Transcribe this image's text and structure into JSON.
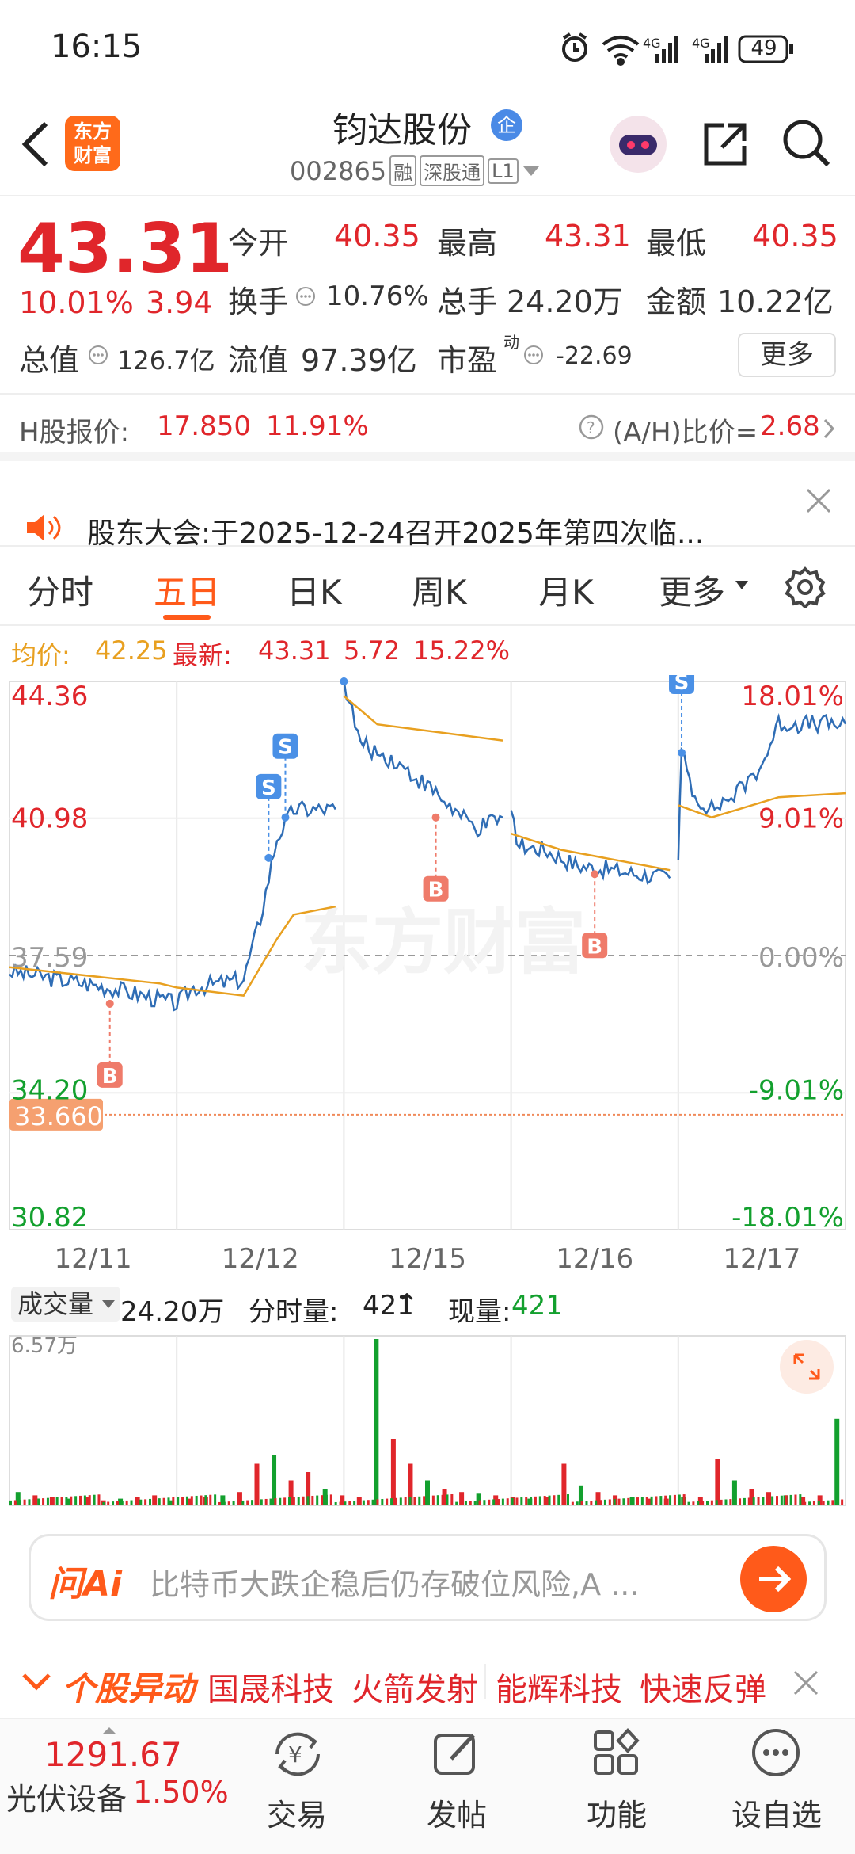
{
  "status": {
    "time": "16:15",
    "battery": "49"
  },
  "nav": {
    "logo_line1": "东方",
    "logo_line2": "财富",
    "title": "钧达股份",
    "badge": "企",
    "code": "002865",
    "tags": [
      "融",
      "深股通",
      "L1"
    ]
  },
  "quote": {
    "price": "43.31",
    "change_pct": "10.01%",
    "change": "3.94",
    "open_label": "今开",
    "open": "40.35",
    "high_label": "最高",
    "high": "43.31",
    "low_label": "最低",
    "low": "40.35",
    "turnover_label": "换手",
    "turnover": "10.76%",
    "vol_label": "总手",
    "vol": "24.20万",
    "amount_label": "金额",
    "amount": "10.22亿",
    "mcap_label": "总值",
    "mcap": "126.7亿",
    "float_label": "流值",
    "float_cap": "97.39亿",
    "pe_label": "市盈",
    "pe_sup": "动",
    "pe": "-22.69",
    "more": "更多"
  },
  "hshare": {
    "label": "H股报价:",
    "price": "17.850",
    "pct": "11.91%",
    "ratio_label": "(A/H)比价=",
    "ratio": "2.68"
  },
  "notice": {
    "text": "股东大会:于2025-12-24召开2025年第四次临..."
  },
  "tabs": [
    "分时",
    "五日",
    "日K",
    "周K",
    "月K",
    "更多"
  ],
  "stats": {
    "avg_label": "均价:",
    "avg": "42.25",
    "latest_label": "最新:",
    "latest": "43.31",
    "chg": "5.72",
    "pct": "15.22%"
  },
  "chart_data": {
    "type": "line",
    "title": "五日分时",
    "x": [
      "12/11",
      "12/12",
      "12/15",
      "12/16",
      "12/17"
    ],
    "ylim": [
      30.82,
      44.36
    ],
    "y_ticks": [
      "44.36",
      "40.98",
      "37.59",
      "34.20",
      "30.82"
    ],
    "pct_ticks": [
      "18.01%",
      "9.01%",
      "0.00%",
      "-9.01%",
      "-18.01%"
    ],
    "prev_close": 37.59,
    "marker_line": "33.660",
    "series": [
      {
        "name": "price",
        "color": "#2f6db5",
        "values": [
          [
            0,
            37.2
          ],
          [
            0.3,
            37.0
          ],
          [
            0.6,
            36.8
          ],
          [
            0.9,
            36.5
          ],
          [
            1.0,
            36.4
          ],
          [
            1.1,
            36.8
          ],
          [
            1.4,
            37.0
          ],
          [
            1.5,
            38.5
          ],
          [
            1.6,
            40.5
          ],
          [
            1.7,
            41.2
          ],
          [
            1.95,
            41.2
          ]
        ],
        "segments": [
          [
            [
              2.0,
              44.36
            ],
            [
              2.1,
              42.8
            ],
            [
              2.3,
              42.4
            ],
            [
              2.55,
              41.6
            ],
            [
              2.7,
              41.0
            ],
            [
              2.8,
              40.7
            ],
            [
              2.95,
              41.0
            ]
          ],
          [
            [
              3.0,
              41.0
            ],
            [
              3.05,
              40.3
            ],
            [
              3.2,
              40.2
            ],
            [
              3.4,
              39.8
            ],
            [
              3.6,
              39.7
            ],
            [
              3.75,
              39.6
            ],
            [
              3.95,
              39.5
            ]
          ],
          [
            [
              4.0,
              40.1
            ],
            [
              4.02,
              42.6
            ],
            [
              4.1,
              41.5
            ],
            [
              4.2,
              41.2
            ],
            [
              4.35,
              41.6
            ],
            [
              4.5,
              42.3
            ],
            [
              4.6,
              43.31
            ],
            [
              5.0,
              43.31
            ]
          ]
        ]
      },
      {
        "name": "avg",
        "color": "#e8a020",
        "values": [
          [
            0,
            37.3
          ],
          [
            0.9,
            36.9
          ],
          [
            1.0,
            36.8
          ],
          [
            1.4,
            36.6
          ],
          [
            1.6,
            38.0
          ],
          [
            1.7,
            38.6
          ],
          [
            1.95,
            38.8
          ]
        ],
        "segments": [
          [
            [
              2.0,
              44.0
            ],
            [
              2.2,
              43.3
            ],
            [
              2.95,
              42.9
            ]
          ],
          [
            [
              3.0,
              40.6
            ],
            [
              3.3,
              40.2
            ],
            [
              3.95,
              39.7
            ]
          ],
          [
            [
              4.0,
              41.3
            ],
            [
              4.2,
              41.0
            ],
            [
              4.6,
              41.5
            ],
            [
              5.0,
              41.6
            ]
          ]
        ]
      }
    ],
    "trades": [
      {
        "type": "S",
        "x": 1.55,
        "y": 40.0
      },
      {
        "type": "S",
        "x": 1.65,
        "y": 41.0
      },
      {
        "type": "S",
        "x": 2.0,
        "y": 44.36
      },
      {
        "type": "B",
        "x": 0.6,
        "y": 36.4
      },
      {
        "type": "B",
        "x": 2.55,
        "y": 41.0
      },
      {
        "type": "B",
        "x": 3.5,
        "y": 39.6
      },
      {
        "type": "S",
        "x": 4.02,
        "y": 42.6
      }
    ]
  },
  "volume": {
    "label": "成交量",
    "total": "24.20万",
    "tick_label": "分时量:",
    "tick": "421",
    "now_label": "现量:",
    "now": "421",
    "max": "6.57万",
    "bars": [
      0.08,
      0.06,
      0.05,
      0.04,
      0.05,
      0.03,
      0.04,
      0.05,
      0.06,
      0.03,
      0.04,
      0.05,
      0.06,
      0.08,
      0.25,
      0.3,
      0.15,
      0.2,
      0.1,
      0.06,
      0.05,
      1.0,
      0.4,
      0.25,
      0.15,
      0.1,
      0.08,
      0.07,
      0.06,
      0.05,
      0.04,
      0.05,
      0.25,
      0.12,
      0.08,
      0.06,
      0.05,
      0.04,
      0.04,
      0.05,
      0.05,
      0.28,
      0.15,
      0.1,
      0.08,
      0.06,
      0.05,
      0.06,
      0.52
    ]
  },
  "ai": {
    "brand": "问Ai",
    "placeholder": "比特币大跌企稳后仍存破位风险,A ..."
  },
  "ticker": {
    "label": "个股异动",
    "items": [
      "国晟科技",
      "火箭发射",
      "能辉科技",
      "快速反弹"
    ]
  },
  "bottom": {
    "index_value": "1291.67",
    "index_name": "光伏设备",
    "index_pct": "1.50%",
    "items": [
      "交易",
      "发帖",
      "功能",
      "设自选"
    ]
  }
}
